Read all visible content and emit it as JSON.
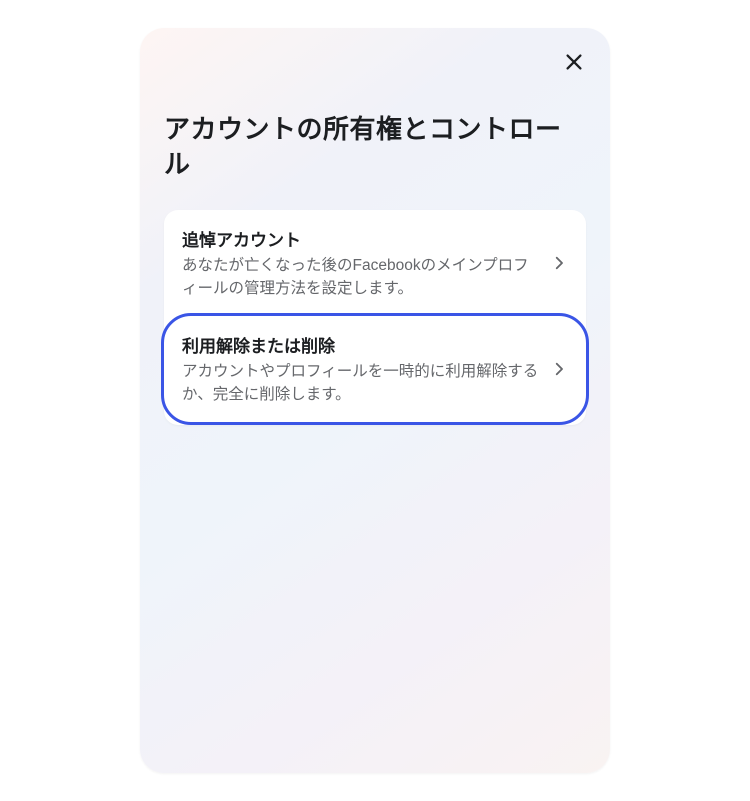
{
  "panel": {
    "title": "アカウントの所有権とコントロール",
    "items": [
      {
        "title": "追悼アカウント",
        "description": "あなたが亡くなった後のFacebookのメインプロフィールの管理方法を設定します。"
      },
      {
        "title": "利用解除または削除",
        "description": "アカウントやプロフィールを一時的に利用解除するか、完全に削除します。"
      }
    ]
  }
}
